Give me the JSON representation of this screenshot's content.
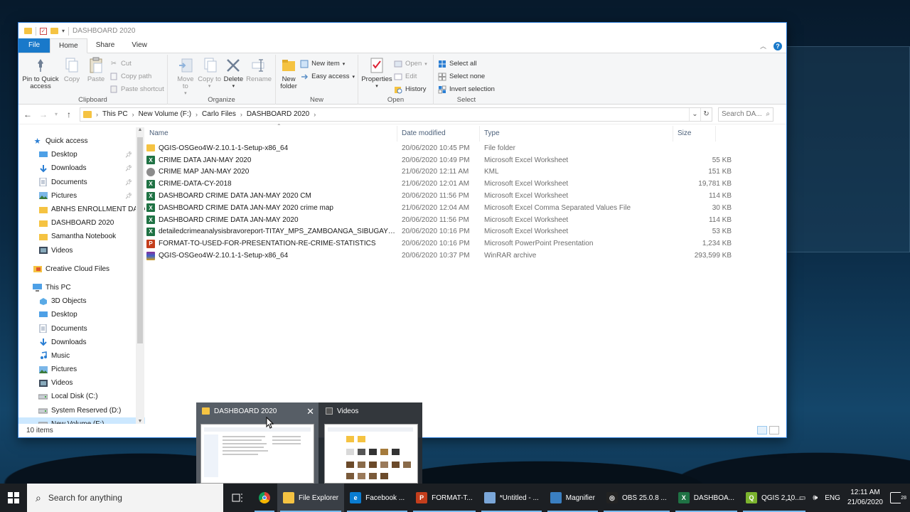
{
  "window": {
    "title": "DASHBOARD 2020",
    "tabs": [
      "File",
      "Home",
      "Share",
      "View"
    ],
    "active_tab": "Home"
  },
  "ribbon": {
    "clipboard": {
      "label": "Clipboard",
      "pin": "Pin to Quick access",
      "copy": "Copy",
      "paste": "Paste",
      "cut": "Cut",
      "copy_path": "Copy path",
      "paste_shortcut": "Paste shortcut"
    },
    "organize": {
      "label": "Organize",
      "move_to": "Move to",
      "copy_to": "Copy to",
      "delete": "Delete",
      "rename": "Rename"
    },
    "new": {
      "label": "New",
      "new_folder": "New folder",
      "new_item": "New item",
      "easy_access": "Easy access"
    },
    "open": {
      "label": "Open",
      "properties": "Properties",
      "open": "Open",
      "edit": "Edit",
      "history": "History"
    },
    "select": {
      "label": "Select",
      "select_all": "Select all",
      "select_none": "Select none",
      "invert": "Invert selection"
    }
  },
  "address": {
    "crumbs": [
      "This PC",
      "New Volume (F:)",
      "Carlo Files",
      "DASHBOARD 2020"
    ],
    "search_placeholder": "Search DA..."
  },
  "nav": {
    "quick_access": "Quick access",
    "quick_items": [
      {
        "label": "Desktop",
        "icon": "desktop-icon",
        "pinned": true
      },
      {
        "label": "Downloads",
        "icon": "download-icon",
        "pinned": true
      },
      {
        "label": "Documents",
        "icon": "documents-icon",
        "pinned": true
      },
      {
        "label": "Pictures",
        "icon": "pictures-icon",
        "pinned": true
      },
      {
        "label": "ABNHS ENROLLMENT DATA",
        "icon": "folder-icon",
        "pinned": false
      },
      {
        "label": "DASHBOARD 2020",
        "icon": "folder-icon",
        "pinned": false
      },
      {
        "label": "Samantha Notebook",
        "icon": "folder-icon",
        "pinned": false
      },
      {
        "label": "Videos",
        "icon": "videos-icon",
        "pinned": false
      }
    ],
    "creative_cloud": "Creative Cloud Files",
    "this_pc": "This PC",
    "pc_items": [
      {
        "label": "3D Objects",
        "icon": "cube-icon"
      },
      {
        "label": "Desktop",
        "icon": "desktop-icon"
      },
      {
        "label": "Documents",
        "icon": "documents-icon"
      },
      {
        "label": "Downloads",
        "icon": "download-icon"
      },
      {
        "label": "Music",
        "icon": "music-icon"
      },
      {
        "label": "Pictures",
        "icon": "pictures-icon"
      },
      {
        "label": "Videos",
        "icon": "videos-icon"
      },
      {
        "label": "Local Disk (C:)",
        "icon": "drive-icon"
      },
      {
        "label": "System Reserved (D:)",
        "icon": "drive-icon"
      },
      {
        "label": "New Volume (F:)",
        "icon": "drive-icon"
      }
    ]
  },
  "columns": {
    "name": "Name",
    "date": "Date modified",
    "type": "Type",
    "size": "Size"
  },
  "files": [
    {
      "name": "QGIS-OSGeo4W-2.10.1-1-Setup-x86_64",
      "date": "20/06/2020 10:45 PM",
      "type": "File folder",
      "size": "",
      "kind": "folder"
    },
    {
      "name": "CRIME DATA JAN-MAY 2020",
      "date": "20/06/2020 10:49 PM",
      "type": "Microsoft Excel Worksheet",
      "size": "55 KB",
      "kind": "excel"
    },
    {
      "name": "CRIME MAP JAN-MAY 2020",
      "date": "21/06/2020 12:11 AM",
      "type": "KML",
      "size": "151 KB",
      "kind": "kml"
    },
    {
      "name": "CRIME-DATA-CY-2018",
      "date": "21/06/2020 12:01 AM",
      "type": "Microsoft Excel Worksheet",
      "size": "19,781 KB",
      "kind": "excel"
    },
    {
      "name": "DASHBOARD CRIME DATA JAN-MAY 2020 CM",
      "date": "20/06/2020 11:56 PM",
      "type": "Microsoft Excel Worksheet",
      "size": "114 KB",
      "kind": "excel"
    },
    {
      "name": "DASHBOARD CRIME DATA JAN-MAY 2020 crime map",
      "date": "21/06/2020 12:04 AM",
      "type": "Microsoft Excel Comma Separated Values File",
      "size": "30 KB",
      "kind": "csv"
    },
    {
      "name": "DASHBOARD CRIME DATA JAN-MAY 2020",
      "date": "20/06/2020 11:56 PM",
      "type": "Microsoft Excel Worksheet",
      "size": "114 KB",
      "kind": "excel"
    },
    {
      "name": "detailedcrimeanalysisbravoreport-TITAY_MPS_ZAMBOANGA_SIBUGAY_PPO...",
      "date": "20/06/2020 10:16 PM",
      "type": "Microsoft Excel Worksheet",
      "size": "53 KB",
      "kind": "excel"
    },
    {
      "name": "FORMAT-TO-USED-FOR-PRESENTATION-RE-CRIME-STATISTICS",
      "date": "20/06/2020 10:16 PM",
      "type": "Microsoft PowerPoint Presentation",
      "size": "1,234 KB",
      "kind": "ppt"
    },
    {
      "name": "QGIS-OSGeo4W-2.10.1-1-Setup-x86_64",
      "date": "20/06/2020 10:37 PM",
      "type": "WinRAR archive",
      "size": "293,599 KB",
      "kind": "rar"
    }
  ],
  "status": {
    "items": "10 items"
  },
  "thumbnails": [
    {
      "title": "DASHBOARD 2020"
    },
    {
      "title": "Videos"
    }
  ],
  "taskbar": {
    "search_placeholder": "Search for anything",
    "apps": [
      {
        "label": "File Explorer",
        "color": "#f5c342",
        "glyph": "",
        "active": true
      },
      {
        "label": "Facebook ...",
        "color": "#0a7cd0",
        "glyph": "e",
        "active": false
      },
      {
        "label": "FORMAT-T...",
        "color": "#c43e1c",
        "glyph": "P",
        "active": false
      },
      {
        "label": "*Untitled - ...",
        "color": "#7aa6d8",
        "glyph": "",
        "active": false
      },
      {
        "label": "Magnifier",
        "color": "#3a7fc1",
        "glyph": "",
        "active": false
      },
      {
        "label": "OBS 25.0.8 ...",
        "color": "#222222",
        "glyph": "◎",
        "active": false
      },
      {
        "label": "DASHBOA...",
        "color": "#1f7244",
        "glyph": "X",
        "active": false
      },
      {
        "label": "QGIS 2.10....",
        "color": "#7bb32e",
        "glyph": "Q",
        "active": false
      }
    ],
    "lang": "ENG",
    "time": "12:11 AM",
    "date": "21/06/2020",
    "notifications": "28"
  }
}
